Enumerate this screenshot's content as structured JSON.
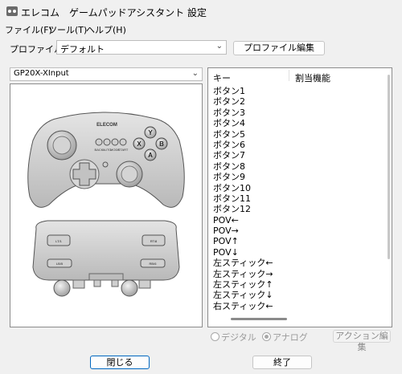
{
  "window": {
    "title": "エレコム　ゲームパッドアシスタント 設定"
  },
  "menu": [
    "ファイル(F)",
    "ツール(T)",
    "ヘルプ(H)"
  ],
  "profile": {
    "label": "プロファイル:",
    "value": "デフォルト",
    "edit_label": "プロファイル編集"
  },
  "device": {
    "value": "GP20X-XInput"
  },
  "controller": {
    "logo": "ELECOM",
    "face_buttons": [
      "Y",
      "X",
      "B",
      "A"
    ],
    "center_labels": [
      "BACK",
      "AUTO",
      "MODE",
      "START"
    ],
    "shoulder_labels": [
      "LT/1",
      "RT/8",
      "LB/5",
      "RB/6"
    ]
  },
  "key_list": {
    "col_key": "キー",
    "col_func": "割当機能",
    "rows": [
      "ボタン1",
      "ボタン2",
      "ボタン3",
      "ボタン4",
      "ボタン5",
      "ボタン6",
      "ボタン7",
      "ボタン8",
      "ボタン9",
      "ボタン10",
      "ボタン11",
      "ボタン12",
      "POV←",
      "POV→",
      "POV↑",
      "POV↓",
      "左スティック←",
      "左スティック→",
      "左スティック↑",
      "左スティック↓",
      "右スティック←"
    ]
  },
  "mode": {
    "digital": "デジタル",
    "analog": "アナログ",
    "selected": "analog"
  },
  "buttons": {
    "action_edit": "アクション編集",
    "close": "閉じる",
    "exit": "終了"
  }
}
